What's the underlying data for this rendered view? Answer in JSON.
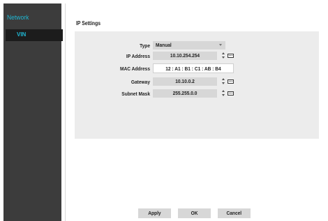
{
  "sidebar": {
    "title": "Network",
    "items": [
      {
        "label": "VIN"
      }
    ]
  },
  "main": {
    "section_title": "IP Settings",
    "fields": {
      "type": {
        "label": "Type",
        "value": "Manual"
      },
      "ip_address": {
        "label": "IP Address",
        "value": "10.10.254.254"
      },
      "mac_address": {
        "label": "MAC Address",
        "value": "12 : A1 : B1 : C1 : AB : B4"
      },
      "gateway": {
        "label": "Gateway",
        "value": "10.10.0.2"
      },
      "subnet_mask": {
        "label": "Subnet Mask",
        "value": "255.255.0.0"
      }
    }
  },
  "buttons": {
    "apply": "Apply",
    "ok": "OK",
    "cancel": "Cancel"
  },
  "colors": {
    "accent": "#1fb6d2",
    "sidebar_bg": "#3c3c3c",
    "selected_item_bg": "#1c1c1c",
    "panel_bg": "#ececec",
    "field_bg": "#d7d7d7"
  }
}
